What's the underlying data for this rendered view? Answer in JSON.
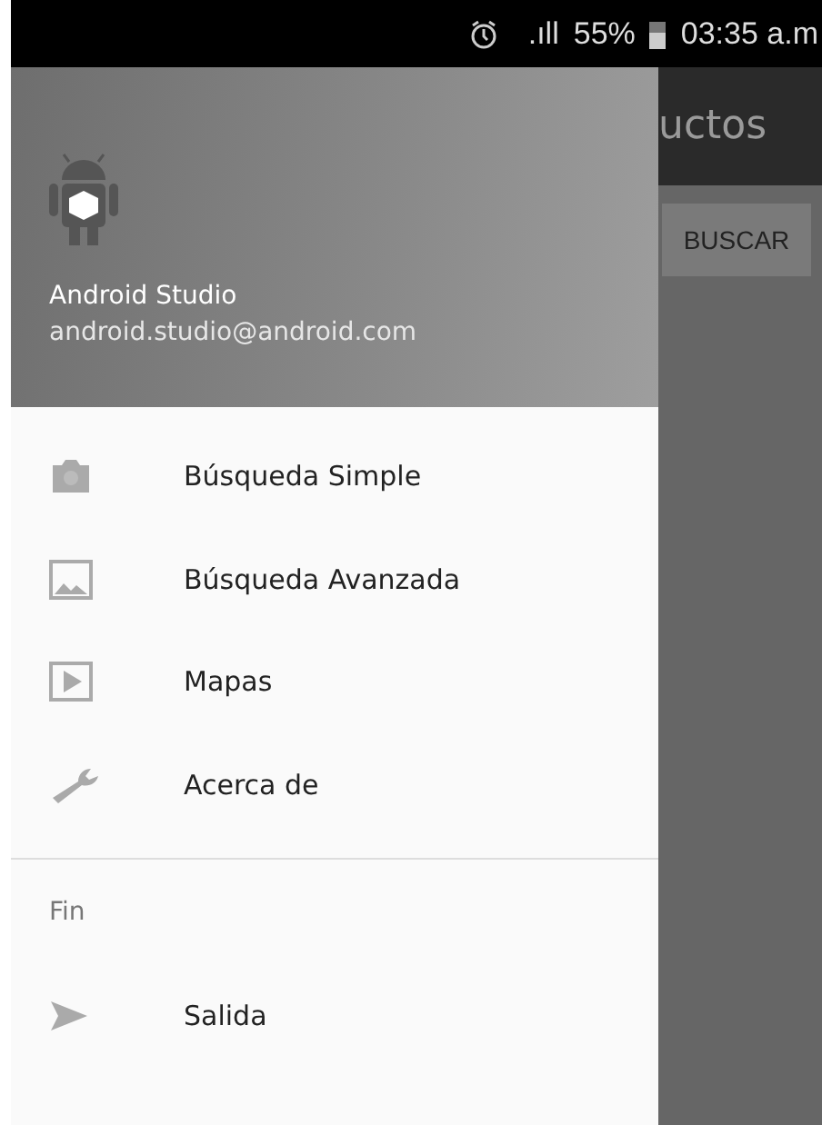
{
  "status_bar": {
    "signal_text": ".ıll",
    "battery": "55%",
    "time": "03:35 a.m"
  },
  "background_app": {
    "title": "uctos",
    "button": "BUSCAR"
  },
  "drawer": {
    "header": {
      "name": "Android Studio",
      "email": "android.studio@android.com"
    },
    "items": [
      {
        "label": "Búsqueda Simple"
      },
      {
        "label": "Búsqueda Avanzada"
      },
      {
        "label": "Mapas"
      },
      {
        "label": "Acerca de"
      }
    ],
    "section": {
      "title": "Fin",
      "items": [
        {
          "label": "Salida"
        }
      ]
    }
  }
}
